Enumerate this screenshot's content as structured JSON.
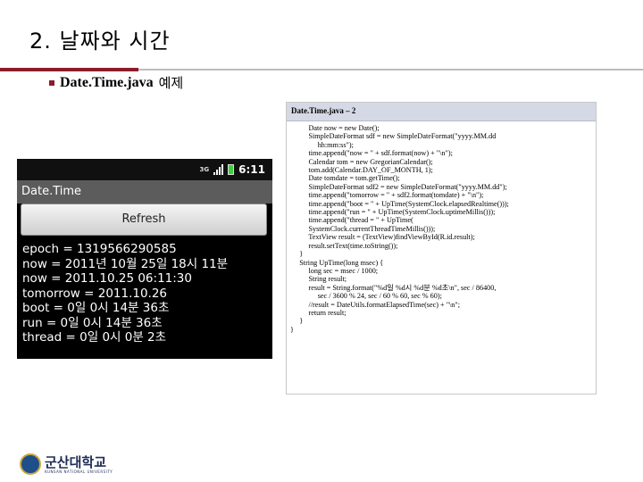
{
  "slide": {
    "title": "2. 날짜와 시간",
    "bullet_bold": "Date.Time.java",
    "bullet_rest": "예제"
  },
  "code_panel": {
    "header": "Date.Time.java – 2",
    "lines": [
      "          Date now = new Date();",
      "          SimpleDateFormat sdf = new SimpleDateFormat(\"yyyy.MM.dd",
      "               hh:mm:ss\");",
      "          time.append(\"now = \" + sdf.format(now) + \"\\n\");",
      "          Calendar tom = new GregorianCalendar();",
      "          tom.add(Calendar.DAY_OF_MONTH, 1);",
      "          Date tomdate = tom.getTime();",
      "          SimpleDateFormat sdf2 = new SimpleDateFormat(\"yyyy.MM.dd\");",
      "          time.append(\"tomorrow = \" + sdf2.format(tomdate) + \"\\n\");",
      "          time.append(\"boot = \" + UpTime(SystemClock.elapsedRealtime()));",
      "          time.append(\"run = \" + UpTime(SystemClock.uptimeMillis()));",
      "          time.append(\"thread = \" + UpTime(",
      "          SystemClock.currentThreadTimeMillis()));",
      "          TextView result = (TextView)findViewById(R.id.result);",
      "          result.setText(time.toString());",
      "     }",
      "     String UpTime(long msec) {",
      "          long sec = msec / 1000;",
      "          String result;",
      "          result = String.format(\"%d일 %d시 %d분 %d초\\n\", sec / 86400,",
      "               sec / 3600 % 24, sec / 60 % 60, sec % 60);",
      "          //result = DateUtils.formatElapsedTime(sec) + \"\\n\";",
      "          return result;",
      "     }",
      "}"
    ]
  },
  "phone": {
    "status_net": "3G",
    "status_time": "6:11",
    "app_title": "Date.Time",
    "refresh_label": "Refresh",
    "output": [
      "epoch = 1319566290585",
      "now = 2011년 10월 25일 18시 11분",
      "now = 2011.10.25 06:11:30",
      "tomorrow = 2011.10.26",
      "boot = 0일 0시 14분 36초",
      "run = 0일 0시 14분 36초",
      "thread = 0일 0시 0분 2초"
    ]
  },
  "footer": {
    "logo_name": "군산대학교",
    "logo_sub": "KUNSAN NATIONAL UNIVERSITY"
  }
}
